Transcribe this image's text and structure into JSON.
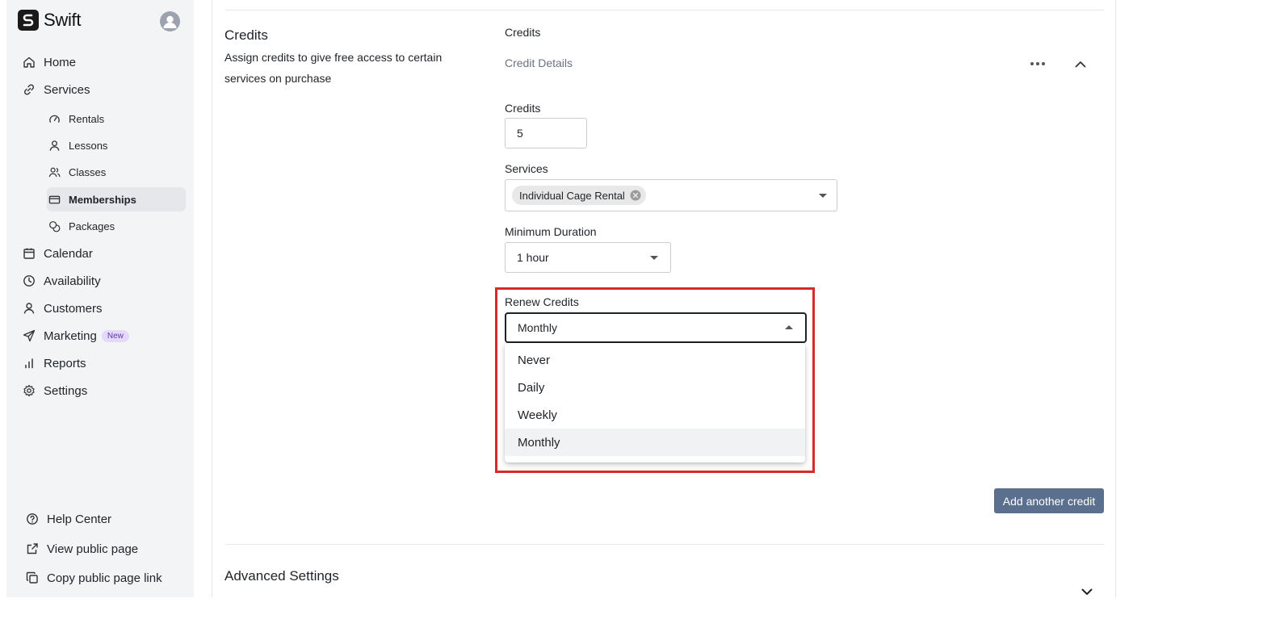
{
  "app": {
    "name": "Swift"
  },
  "sidebar": {
    "nav": [
      {
        "label": "Home",
        "icon": "home-icon"
      },
      {
        "label": "Services",
        "icon": "link-icon"
      }
    ],
    "services_sub": [
      {
        "label": "Rentals",
        "icon": "gauge-icon"
      },
      {
        "label": "Lessons",
        "icon": "user-icon"
      },
      {
        "label": "Classes",
        "icon": "users-icon"
      },
      {
        "label": "Memberships",
        "icon": "card-icon",
        "active": true
      },
      {
        "label": "Packages",
        "icon": "coins-icon"
      }
    ],
    "nav2": [
      {
        "label": "Calendar",
        "icon": "calendar-icon"
      },
      {
        "label": "Availability",
        "icon": "clock-icon"
      },
      {
        "label": "Customers",
        "icon": "user-icon"
      },
      {
        "label": "Marketing",
        "icon": "send-icon",
        "badge": "New"
      },
      {
        "label": "Reports",
        "icon": "bar-chart-icon"
      },
      {
        "label": "Settings",
        "icon": "gear-icon"
      }
    ],
    "footer": [
      {
        "label": "Help Center",
        "icon": "help-icon"
      },
      {
        "label": "View public page",
        "icon": "external-link-icon"
      },
      {
        "label": "Copy public page link",
        "icon": "copy-icon"
      }
    ]
  },
  "credits_section": {
    "title": "Credits",
    "description": "Assign credits to give free access to certain services on purchase",
    "field_header": "Credits",
    "details_label": "Credit Details",
    "credits_label": "Credits",
    "credits_value": "5",
    "services_label": "Services",
    "services_selected": [
      "Individual Cage Rental"
    ],
    "min_duration_label": "Minimum Duration",
    "min_duration_value": "1 hour",
    "renew_label": "Renew Credits",
    "renew_value": "Monthly",
    "renew_options": [
      "Never",
      "Daily",
      "Weekly",
      "Monthly"
    ],
    "add_button": "Add another credit"
  },
  "advanced_section": {
    "title": "Advanced Settings"
  },
  "colors": {
    "accent_button": "#5b6f8e",
    "highlight": "#d72b2b",
    "badge_bg": "#e5d9fb"
  }
}
